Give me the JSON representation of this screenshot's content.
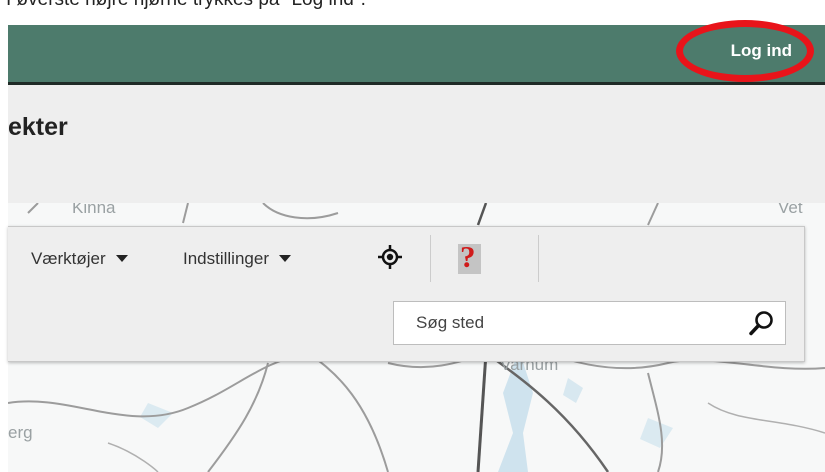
{
  "instruction": "I øverste højre hjørne trykkes på \"Log ind\".",
  "topbar": {
    "login_label": "Log ind",
    "background": "#4d7b6c",
    "highlight_color": "#e8141a"
  },
  "header": {
    "title_fragment": "ekter"
  },
  "map": {
    "labels": {
      "top_left": "Kinna",
      "top_right": "Vet",
      "bottom_left": "erg",
      "center": "Varnum"
    }
  },
  "toolbar": {
    "tools_label": "Værktøjer",
    "settings_label": "Indstillinger",
    "locate_icon": "crosshair-icon",
    "help_label": "?"
  },
  "search": {
    "placeholder": "Søg sted",
    "value": ""
  }
}
